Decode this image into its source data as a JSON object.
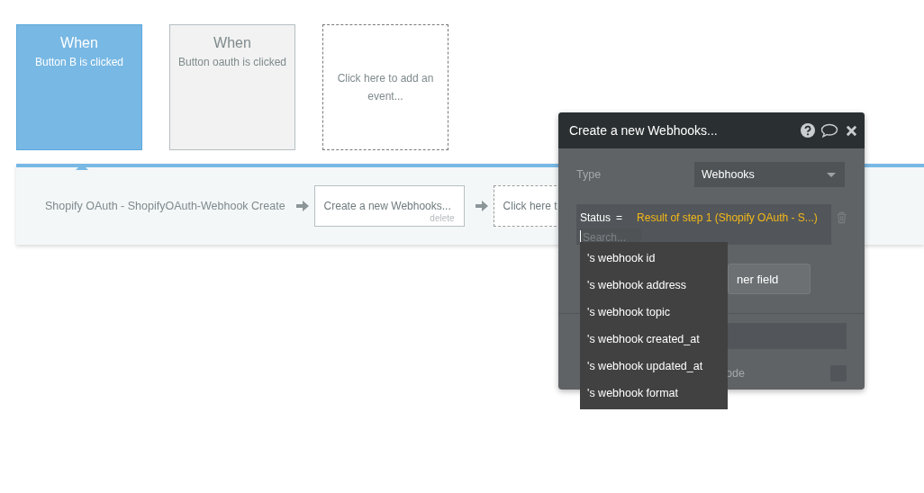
{
  "events": [
    {
      "title": "When",
      "subtitle": "Button B is clicked",
      "selected": true
    },
    {
      "title": "When",
      "subtitle": "Button oauth is clicked",
      "selected": false
    }
  ],
  "add_event": "Click here to add an event...",
  "workflow": {
    "steps": [
      {
        "kind": "text",
        "label": "Shopify OAuth - ShopifyOAuth-Webhook Create"
      },
      {
        "kind": "action",
        "label": "Create a new Webhooks...",
        "delete": "delete"
      },
      {
        "kind": "add",
        "label": "Click here t"
      }
    ]
  },
  "panel": {
    "title": "Create a new Webhooks...",
    "type_label": "Type",
    "type_value": "Webhooks",
    "field": {
      "name": "Status",
      "operator": "=",
      "value": "Result of step 1 (Shopify OAuth - S...)"
    },
    "search": {
      "placeholder": "Search..."
    },
    "options": [
      "'s webhook id",
      "'s webhook address",
      "'s webhook topic",
      "'s webhook created_at",
      "'s webhook updated_at",
      "'s webhook format"
    ],
    "add_field_button": "ner field",
    "check_text": "ode",
    "checkbox": {
      "checked": false
    }
  }
}
